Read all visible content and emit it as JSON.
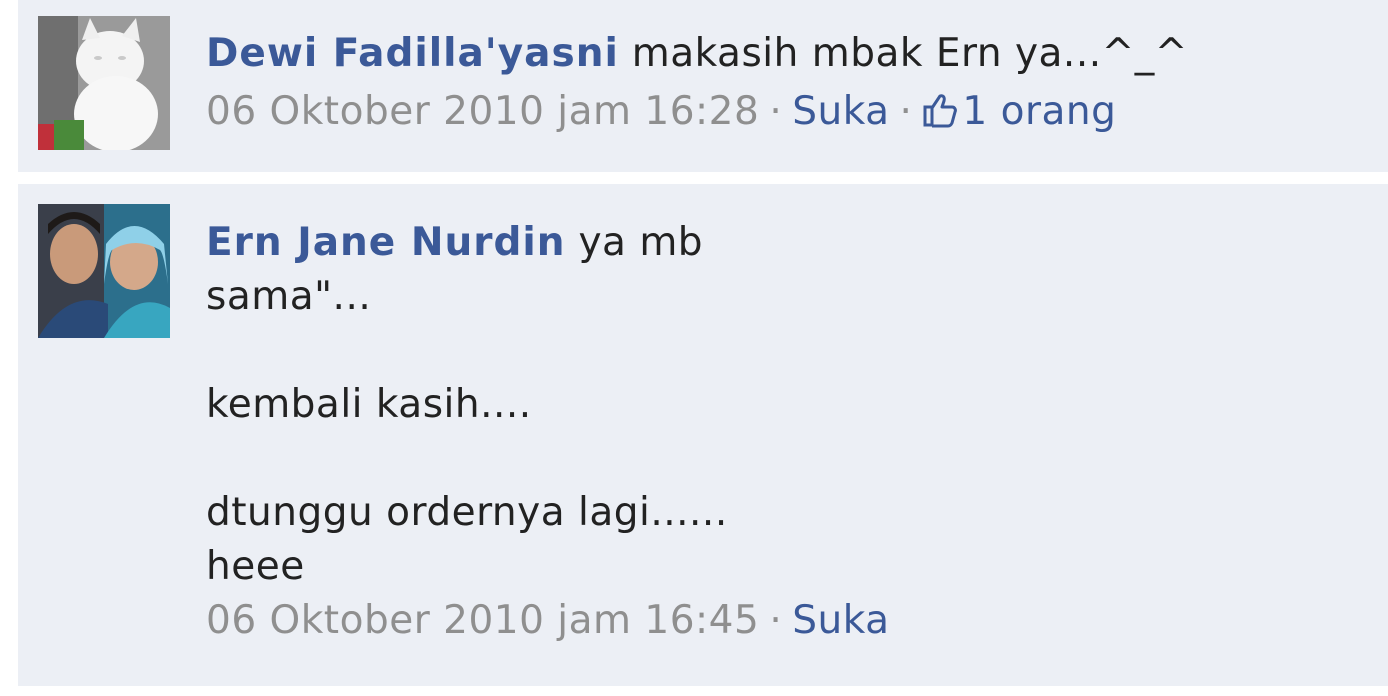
{
  "comments": [
    {
      "author": "Dewi Fadilla'yasni",
      "text": "makasih mbak Ern ya...^_^",
      "timestamp": "06 Oktober 2010 jam 16:28",
      "like_label": "Suka",
      "like_count": "1 orang",
      "avatar_icon": "white-cat-avatar"
    },
    {
      "author": "Ern Jane Nurdin",
      "text": "ya mb\nsama\"...\n\nkembali kasih....\n\ndtunggu ordernya lagi......\nheee",
      "timestamp": "06 Oktober 2010 jam 16:45",
      "like_label": "Suka",
      "avatar_icon": "couple-photo-avatar"
    }
  ],
  "colors": {
    "link": "#3b5998",
    "background": "#eceff5",
    "meta": "#8f8f8f"
  }
}
